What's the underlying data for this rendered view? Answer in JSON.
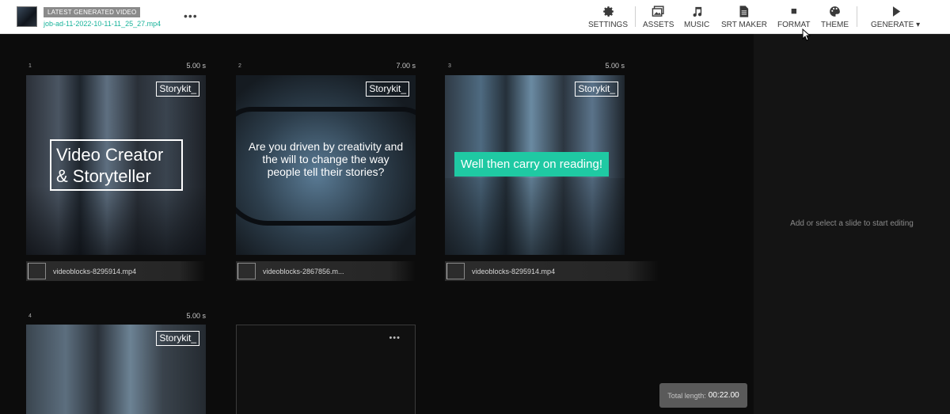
{
  "header": {
    "latest_label": "LATEST GENERATED VIDEO",
    "filename": "job-ad-11-2022-10-11-11_25_27.mp4",
    "more": "•••",
    "tools": [
      {
        "label": "SETTINGS",
        "icon": "gear-icon"
      },
      {
        "label": "ASSETS",
        "icon": "images-icon"
      },
      {
        "label": "MUSIC",
        "icon": "music-note-icon"
      },
      {
        "label": "SRT MAKER",
        "icon": "document-icon"
      },
      {
        "label": "FORMAT",
        "icon": "square-icon"
      },
      {
        "label": "THEME",
        "icon": "palette-icon"
      },
      {
        "label": "GENERATE",
        "icon": "play-icon",
        "dropdown": "▾"
      }
    ]
  },
  "slides": [
    {
      "number": "1",
      "duration": "5.00 s",
      "logo": "Storykit_",
      "text_line1": "Video Creator",
      "text_line2": "& Storyteller",
      "asset": "videoblocks-8295914.mp4"
    },
    {
      "number": "2",
      "duration": "7.00 s",
      "logo": "Storykit_",
      "text": "Are you driven by creativity and the will to change the way people tell their stories?",
      "asset": "videoblocks-2867856.m..."
    },
    {
      "number": "3",
      "duration": "5.00 s",
      "logo": "Storykit_",
      "text": "Well then carry on reading!",
      "asset": "videoblocks-8295914.mp4"
    },
    {
      "number": "4",
      "duration": "5.00 s",
      "logo": "Storykit_"
    }
  ],
  "add_slide": {
    "more": "•••"
  },
  "editor_hint": "Add or select a slide to start editing",
  "total": {
    "label": "Total length:",
    "value": "00:22.00"
  },
  "colors": {
    "accent": "#18b39a",
    "highlight": "#1fc9a3",
    "background": "#0c0c0c"
  }
}
